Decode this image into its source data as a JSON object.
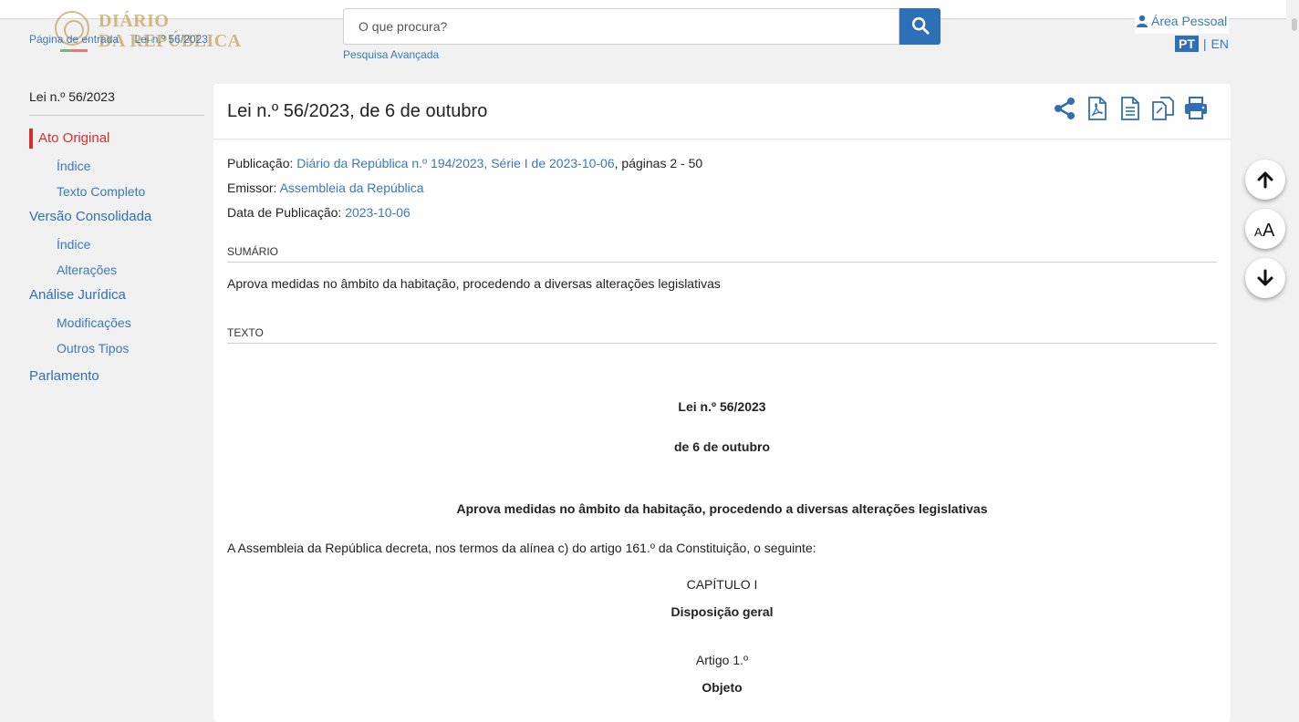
{
  "logo": {
    "line1": "DIÁRIO",
    "line2": "DA REPÚBLICA"
  },
  "breadcrumb": [
    "Página de entrada",
    "Lei n.º 56/2023"
  ],
  "search": {
    "placeholder": "O que procura?",
    "advanced_label": "Pesquisa Avançada"
  },
  "user": {
    "area_label": "Área Pessoal"
  },
  "lang": {
    "pt": "PT",
    "sep": "|",
    "en": "EN"
  },
  "sidebar": {
    "title": "Lei n.º 56/2023",
    "items": [
      {
        "label": "Ato Original",
        "level": "main",
        "active": true
      },
      {
        "label": "Índice",
        "level": "sub"
      },
      {
        "label": "Texto Completo",
        "level": "sub"
      },
      {
        "label": "Versão Consolidada",
        "level": "main"
      },
      {
        "label": "Índice",
        "level": "sub"
      },
      {
        "label": "Alterações",
        "level": "sub"
      },
      {
        "label": "Análise Jurídica",
        "level": "main"
      },
      {
        "label": "Modificações",
        "level": "sub"
      },
      {
        "label": "Outros Tipos",
        "level": "sub"
      },
      {
        "label": "Parlamento",
        "level": "main"
      }
    ]
  },
  "doc": {
    "title": "Lei n.º 56/2023, de 6 de outubro",
    "tools": [
      "share-icon",
      "pdf-icon",
      "document-icon",
      "copy-icon",
      "print-icon"
    ],
    "publicacao_label": "Publicação:",
    "publicacao_link": "Diário da República n.º 194/2023, Série I de 2023-10-06",
    "publicacao_pages": ", páginas 2 - 50",
    "emissor_label": "Emissor:",
    "emissor_value": "Assembleia da República",
    "data_label": "Data de Publicação:",
    "data_value": "2023-10-06",
    "sumario_heading": "SUMÁRIO",
    "sumario_text": "Aprova medidas no âmbito da habitação, procedendo a diversas alterações legislativas",
    "texto_heading": "TEXTO",
    "body": {
      "law": "Lei n.º 56/2023",
      "date": "de 6 de outubro",
      "subject": "Aprova medidas no âmbito da habitação, procedendo a diversas alterações legislativas",
      "preamble": "A Assembleia da República decreta, nos termos da alínea c) do artigo 161.º da Constituição, o seguinte:",
      "chapter": "CAPÍTULO I",
      "chapter_title": "Disposição geral",
      "article": "Artigo 1.º",
      "article_title": "Objeto"
    }
  },
  "fabs": [
    "arrow-up-icon",
    "font-size-icon",
    "arrow-down-icon"
  ],
  "colors": {
    "brand_blue": "#2f6fb5",
    "link": "#3a78b8",
    "active_red": "#d32f2f",
    "logo_gold": "#b8923a"
  }
}
